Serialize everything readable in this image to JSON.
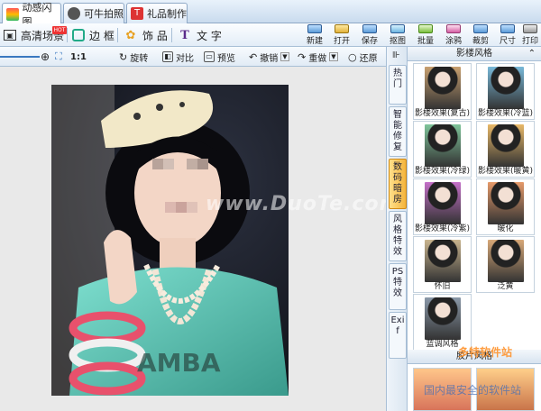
{
  "tabs": [
    {
      "label": "动感闪图"
    },
    {
      "label": "可牛拍照"
    },
    {
      "label": "礼品制作"
    }
  ],
  "tools": [
    {
      "label": "高清场景",
      "badge": "HOT"
    },
    {
      "label": "边 框"
    },
    {
      "label": "饰 品"
    },
    {
      "label": "文 字"
    }
  ],
  "actions": [
    "新建",
    "打开",
    "保存",
    "抠图",
    "批量",
    "涂鸦",
    "裁剪",
    "尺寸",
    "打印"
  ],
  "zoom": {
    "value": "1:1"
  },
  "view_tools": [
    "旋转",
    "对比",
    "预览",
    "撤销",
    "重做",
    "还原"
  ],
  "watermark": "www.DuoTe.com",
  "side_tabs": [
    {
      "label": "热门",
      "active": false
    },
    {
      "label": "智能修复",
      "active": false
    },
    {
      "label": "数码暗房",
      "active": true
    },
    {
      "label": "风格特效",
      "active": false
    },
    {
      "label": "PS特效",
      "active": false
    },
    {
      "label": "Exif",
      "active": false
    }
  ],
  "panel": {
    "section_title": "影楼风格",
    "effects": [
      {
        "label": "影楼效果(复古)",
        "tint": "#c8a070"
      },
      {
        "label": "影楼效果(冷蓝)",
        "tint": "#78b8d8"
      },
      {
        "label": "影楼效果(冷绿)",
        "tint": "#7fc49a"
      },
      {
        "label": "影楼效果(暖黄)",
        "tint": "#e8b868"
      },
      {
        "label": "影楼效果(冷紫)",
        "tint": "#c470c8"
      },
      {
        "label": "暖化",
        "tint": "#e69a6a"
      },
      {
        "label": "怀旧",
        "tint": "#c9b48e"
      },
      {
        "label": "泛黄",
        "tint": "#d8a878"
      },
      {
        "label": "蓝调风格",
        "tint": "#8a98a8"
      }
    ],
    "section2_title": "胶片风格",
    "watermark_brand": "多特软件站",
    "watermark_slogan": "国内最安全的软件站"
  }
}
